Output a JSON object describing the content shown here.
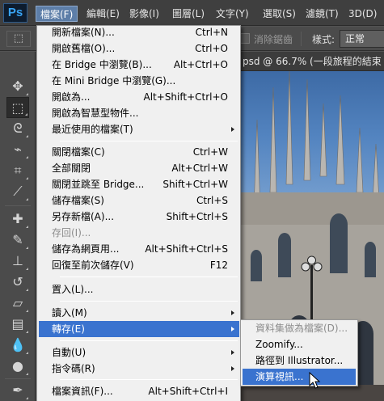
{
  "app": {
    "logo": "Ps"
  },
  "menubar": {
    "items": [
      {
        "label": "檔案(F)",
        "active": true
      },
      {
        "label": "編輯(E)",
        "active": false
      },
      {
        "label": "影像(I)",
        "active": false
      },
      {
        "label": "圖層(L)",
        "active": false
      },
      {
        "label": "文字(Y)",
        "active": false
      },
      {
        "label": "選取(S)",
        "active": false
      },
      {
        "label": "濾鏡(T)",
        "active": false
      },
      {
        "label": "3D(D)",
        "active": false
      }
    ]
  },
  "options": {
    "antialias_label": "消除鋸齒",
    "style_label": "樣式:",
    "style_value": "正常"
  },
  "document": {
    "tab_title": "psd @ 66.7% (一段旅程的結束"
  },
  "file_menu": {
    "items": [
      {
        "label": "開新檔案(N)...",
        "shortcut": "Ctrl+N"
      },
      {
        "label": "開啟舊檔(O)...",
        "shortcut": "Ctrl+O"
      },
      {
        "label": "在 Bridge 中瀏覽(B)...",
        "shortcut": "Alt+Ctrl+O"
      },
      {
        "label": "在 Mini Bridge 中瀏覽(G)...",
        "shortcut": ""
      },
      {
        "label": "開啟為...",
        "shortcut": "Alt+Shift+Ctrl+O"
      },
      {
        "label": "開啟為智慧型物件...",
        "shortcut": ""
      },
      {
        "label": "最近使用的檔案(T)",
        "shortcut": "",
        "submenu": true
      },
      {
        "label": "關閉檔案(C)",
        "shortcut": "Ctrl+W"
      },
      {
        "label": "全部關閉",
        "shortcut": "Alt+Ctrl+W"
      },
      {
        "label": "關閉並跳至 Bridge...",
        "shortcut": "Shift+Ctrl+W"
      },
      {
        "label": "儲存檔案(S)",
        "shortcut": "Ctrl+S"
      },
      {
        "label": "另存新檔(A)...",
        "shortcut": "Shift+Ctrl+S"
      },
      {
        "label": "存回(I)...",
        "shortcut": "",
        "disabled": true
      },
      {
        "label": "儲存為網頁用...",
        "shortcut": "Alt+Shift+Ctrl+S"
      },
      {
        "label": "回復至前次儲存(V)",
        "shortcut": "F12"
      },
      {
        "label": "置入(L)...",
        "shortcut": ""
      },
      {
        "label": "讀入(M)",
        "shortcut": "",
        "submenu": true
      },
      {
        "label": "轉存(E)",
        "shortcut": "",
        "submenu": true,
        "highlighted": true
      },
      {
        "label": "自動(U)",
        "shortcut": "",
        "submenu": true
      },
      {
        "label": "指令碼(R)",
        "shortcut": "",
        "submenu": true
      },
      {
        "label": "檔案資訊(F)...",
        "shortcut": "Alt+Shift+Ctrl+I"
      }
    ]
  },
  "export_submenu": {
    "items": [
      {
        "label": "資料集做為檔案(D)...",
        "disabled": true
      },
      {
        "label": "Zoomify..."
      },
      {
        "label": "路徑到 Illustrator..."
      },
      {
        "label": "演算視訊...",
        "highlighted": true
      }
    ]
  },
  "icons": {
    "move": "move-tool-icon",
    "marquee": "rectangular-marquee-icon",
    "lasso": "lasso-icon",
    "quick_select": "quick-select-icon",
    "crop": "crop-icon",
    "eyedropper": "eyedropper-icon",
    "healing": "spot-healing-brush-icon",
    "brush": "brush-icon",
    "stamp": "clone-stamp-icon",
    "history": "history-brush-icon",
    "eraser": "eraser-icon",
    "gradient": "gradient-icon",
    "blur": "blur-icon",
    "dodge": "dodge-icon",
    "pen": "pen-icon"
  },
  "colors": {
    "highlight": "#3a73cf",
    "menubar_active": "#5d7ea8"
  }
}
